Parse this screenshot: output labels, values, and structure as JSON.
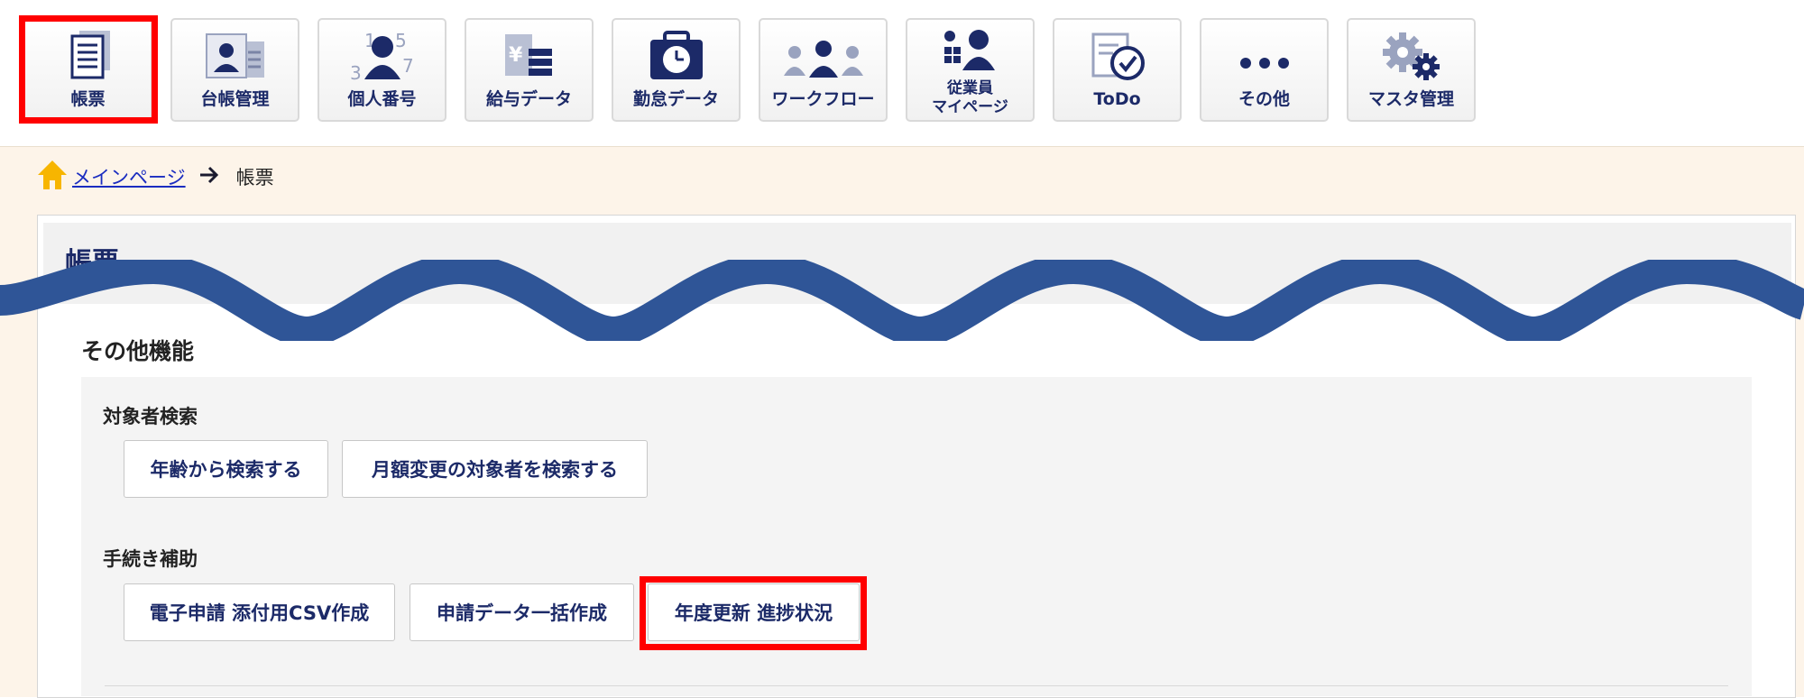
{
  "nav": {
    "items": [
      {
        "label": "帳票",
        "icon": "document-icon",
        "selected": true
      },
      {
        "label": "台帳管理",
        "icon": "id-card-icon"
      },
      {
        "label": "個人番号",
        "icon": "numbered-person-icon"
      },
      {
        "label": "給与データ",
        "icon": "yen-document-icon"
      },
      {
        "label": "勤怠データ",
        "icon": "clock-briefcase-icon"
      },
      {
        "label": "ワークフロー",
        "icon": "people-flow-icon"
      },
      {
        "label1": "従業員",
        "label2": "マイページ",
        "icon": "employee-grid-icon"
      },
      {
        "label": "ToDo",
        "icon": "checklist-icon"
      },
      {
        "label": "その他",
        "icon": "more-dots-icon"
      },
      {
        "label": "マスタ管理",
        "icon": "gears-icon"
      }
    ]
  },
  "breadcrumb": {
    "home": "メインページ",
    "current": "帳票"
  },
  "page": {
    "title": "帳票",
    "section_title": "その他機能"
  },
  "groups": [
    {
      "title": "対象者検索",
      "buttons": [
        "年齢から検索する",
        "月額変更の対象者を検索する"
      ]
    },
    {
      "title": "手続き補助",
      "buttons": [
        "電子申請 添付用CSV作成",
        "申請データ一括作成",
        "年度更新 進捗状況"
      ]
    }
  ],
  "colors": {
    "accent_navy": "#1c2a68",
    "wave": "#2f5597",
    "highlight": "#ff0000",
    "content_bg": "#fdf4e9"
  }
}
